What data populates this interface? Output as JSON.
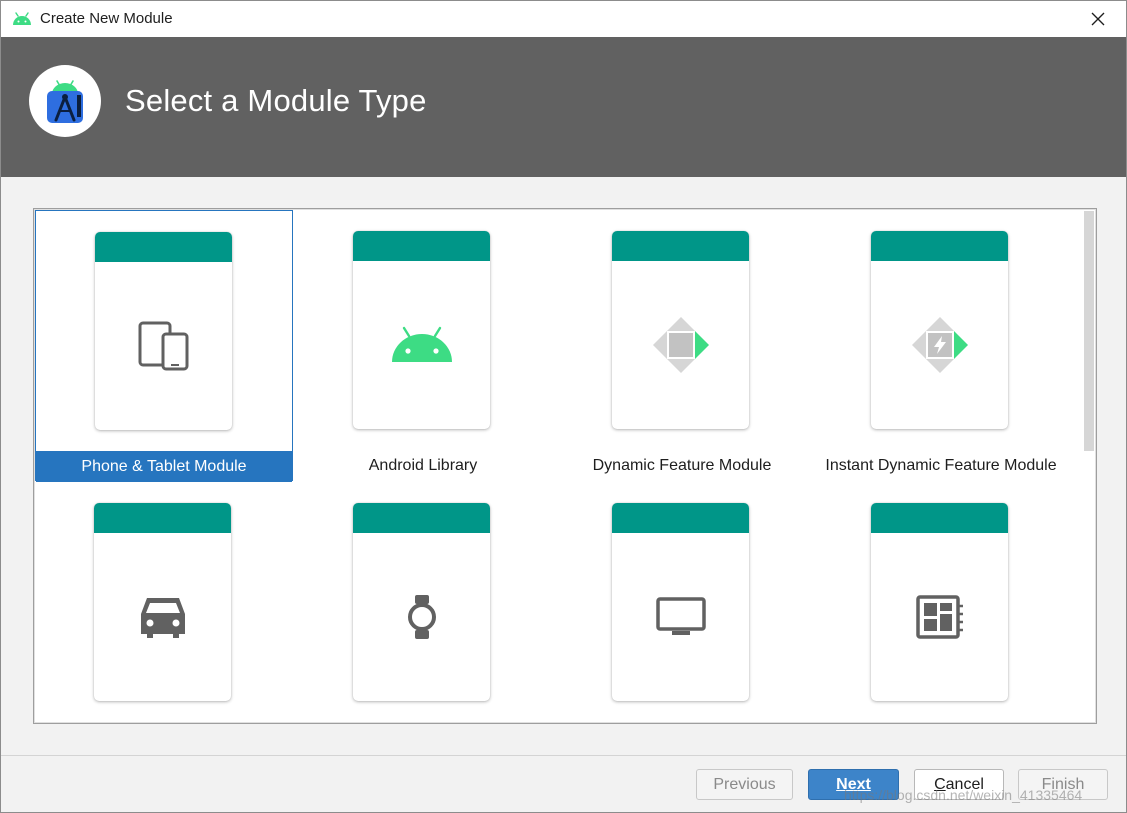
{
  "window": {
    "title": "Create New Module",
    "app_icon": "android-icon",
    "close_icon": "close-icon"
  },
  "header": {
    "title": "Select a Module Type",
    "logo": "android-studio-logo"
  },
  "colors": {
    "banner": "#616161",
    "card_band": "#009688",
    "selection": "#2675bf",
    "android_green": "#3ddc84",
    "icon_gray": "#616161"
  },
  "modules": [
    {
      "label": "Phone & Tablet Module",
      "icon": "phone-tablet-icon",
      "selected": true
    },
    {
      "label": "Android Library",
      "icon": "android-icon",
      "selected": false
    },
    {
      "label": "Dynamic Feature Module",
      "icon": "dynamic-feature-icon",
      "selected": false
    },
    {
      "label": "Instant Dynamic Feature Module",
      "icon": "instant-dynamic-feature-icon",
      "selected": false
    },
    {
      "label": "",
      "icon": "car-icon",
      "selected": false
    },
    {
      "label": "",
      "icon": "watch-icon",
      "selected": false
    },
    {
      "label": "",
      "icon": "tv-icon",
      "selected": false
    },
    {
      "label": "",
      "icon": "things-board-icon",
      "selected": false
    }
  ],
  "footer": {
    "previous": "Previous",
    "next": "Next",
    "cancel_prefix": "",
    "cancel_underlined": "C",
    "cancel_rest": "ancel",
    "finish": "Finish"
  },
  "watermark": "https://blog.csdn.net/weixin_41335464"
}
